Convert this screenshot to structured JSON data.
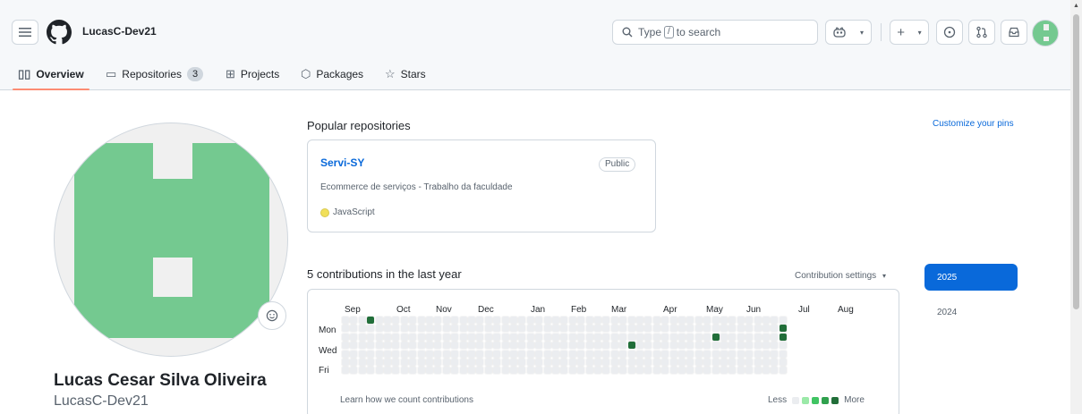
{
  "header": {
    "username": "LucasC-Dev21",
    "search": {
      "prefix": "Type",
      "key": "/",
      "suffix": "to search"
    },
    "icons": [
      "menu-icon",
      "github-logo",
      "search-icon",
      "copilot-icon",
      "plus-icon",
      "issues-icon",
      "pull-request-icon",
      "inbox-icon"
    ]
  },
  "tabs": [
    {
      "label": "Overview",
      "icon": "book-icon",
      "active": true
    },
    {
      "label": "Repositories",
      "icon": "repo-icon",
      "count": "3"
    },
    {
      "label": "Projects",
      "icon": "table-icon"
    },
    {
      "label": "Packages",
      "icon": "package-icon"
    },
    {
      "label": "Stars",
      "icon": "star-icon"
    }
  ],
  "profile": {
    "full_name": "Lucas Cesar Silva Oliveira",
    "login": "LucasC-Dev21",
    "avatar_color": "#74c990"
  },
  "popular": {
    "title": "Popular repositories",
    "customize": "Customize your pins",
    "repos": [
      {
        "name": "Servi-SY",
        "visibility": "Public",
        "description": "Ecommerce de serviços - Trabalho da faculdade",
        "language": "JavaScript",
        "language_color": "#f1e05a"
      }
    ]
  },
  "contributions": {
    "title": "5 contributions in the last year",
    "settings": "Contribution settings",
    "months": [
      "Sep",
      "Oct",
      "Nov",
      "Dec",
      "Jan",
      "Feb",
      "Mar",
      "Apr",
      "May",
      "Jun",
      "Jul",
      "Aug"
    ],
    "days": [
      "Mon",
      "Wed",
      "Fri"
    ],
    "learn": "Learn how we count contributions",
    "less": "Less",
    "more": "More",
    "active_cells": [
      {
        "week": 3,
        "day": 0
      },
      {
        "week": 34,
        "day": 3
      },
      {
        "week": 44,
        "day": 2
      },
      {
        "week": 52,
        "day": 1
      },
      {
        "week": 52,
        "day": 2
      }
    ],
    "colors": {
      "empty": "#ebedf0",
      "l1": "#9be9a8",
      "l2": "#40c463",
      "l3": "#30a14e",
      "l4": "#216e39"
    }
  },
  "years": [
    "2025",
    "2024"
  ]
}
